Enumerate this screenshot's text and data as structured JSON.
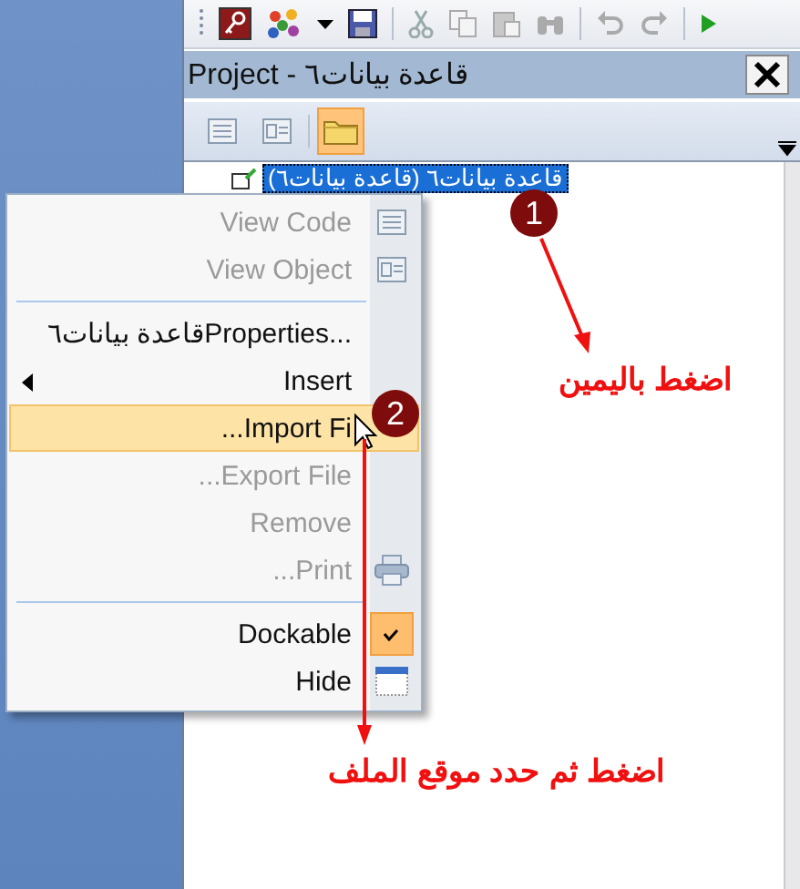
{
  "project_panel": {
    "title": "Project - قاعدة بيانات٦",
    "toolbar": [
      {
        "kind": "view-code",
        "selected": false
      },
      {
        "kind": "view-object",
        "selected": false
      },
      {
        "kind": "folders",
        "selected": true
      }
    ],
    "tree": [
      {
        "label": "قاعدة بيانات٦ (قاعدة بيانات٦)",
        "selected": true
      }
    ]
  },
  "context_menu": [
    {
      "kind": "item",
      "label": "View Code",
      "disabled": true
    },
    {
      "kind": "item",
      "label": "View Object",
      "disabled": true
    },
    {
      "kind": "separator"
    },
    {
      "kind": "item",
      "label": "قاعدة بيانات٦Properties..."
    },
    {
      "kind": "submenu",
      "label": "Insert"
    },
    {
      "kind": "item",
      "label": "...Import Fi",
      "selected": true
    },
    {
      "kind": "item",
      "label": "...Export File",
      "disabled": true
    },
    {
      "kind": "item",
      "label": "Remove",
      "disabled": true
    },
    {
      "kind": "item",
      "label": "...Print",
      "disabled": true
    },
    {
      "kind": "separator"
    },
    {
      "kind": "check",
      "label": "Dockable",
      "checked": true
    },
    {
      "kind": "item",
      "label": "Hide"
    }
  ],
  "annotations": [
    {
      "number": "1",
      "text": "اضغط باليمين"
    },
    {
      "number": "2",
      "text": "اضغط ثم حدد موقع الملف"
    }
  ]
}
